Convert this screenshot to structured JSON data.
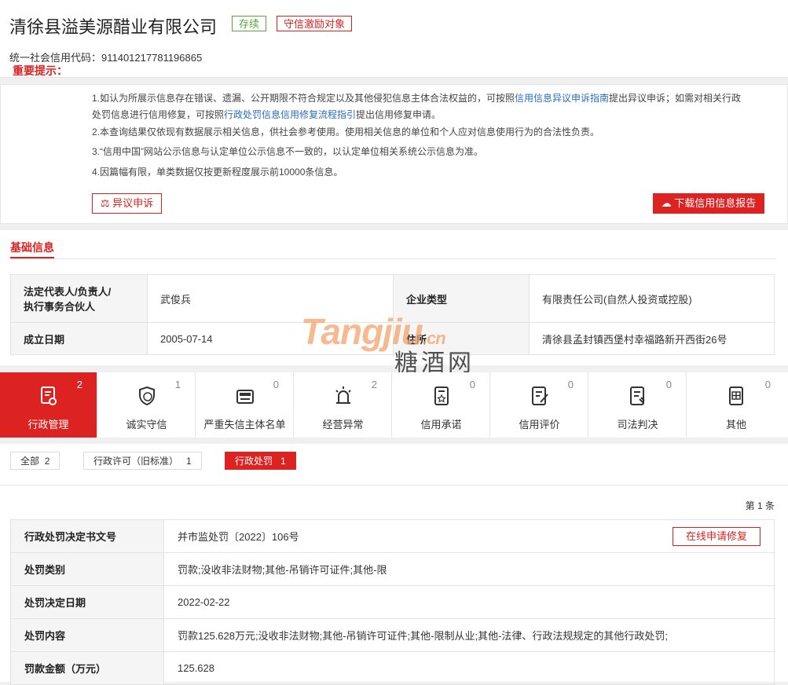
{
  "header": {
    "company_name": "清徐县溢美源醋业有限公司",
    "status_badge": "存续",
    "honor_badge": "守信激励对象",
    "credit_code": "统一社会信用代码：911401217781196865"
  },
  "notice": {
    "label": "重要提示：",
    "line1_a": "1.如认为所展示信息存在错误、遗漏、公开期限不符合规定以及其他侵犯信息主体合法权益的，可按照",
    "line1_link": "信用信息异议申诉指南",
    "line1_b": "提出异议申诉；如需对相关行政",
    "line1c_a": "处罚信息进行信用修复，可按照",
    "line1c_link": "行政处罚信息信用修复流程指引",
    "line1c_b": "提出信用修复申请。",
    "line2": "2.本查询结果仅依现有数据展示相关信息，供社会参考使用。使用相关信息的单位和个人应对信息使用行为的合法性负责。",
    "line3": "3.“信用中国”网站公示信息与认定单位公示信息不一致的，以认定单位相关系统公示信息为准。",
    "line4": "4.因篇幅有限，单类数据仅按更新程度展示前10000条信息。",
    "dispute_button": "异议申诉",
    "download_button": "下载信用信息报告"
  },
  "basic": {
    "section_title": "基础信息",
    "legal_rep_key": "法定代表人/负责人/执行事务合伙人",
    "legal_rep_key_l1": "法定代表人/负责人/",
    "legal_rep_key_l2": "执行事务合伙人",
    "legal_rep_value": "武俊兵",
    "type_key": "企业类型",
    "type_value": "有限责任公司(自然人投资或控股)",
    "founded_key": "成立日期",
    "founded_value": "2005-07-14",
    "address_key": "住所",
    "address_value": "清徐县孟封镇西堡村幸福路新开西街26号",
    "watermark": "Tangjiu",
    "watermark_domain": ".cn",
    "watermark_cn": "糖酒网"
  },
  "tabs": [
    {
      "label": "行政管理",
      "count": "2",
      "icon": "document-stamp-icon",
      "active": true
    },
    {
      "label": "诚实守信",
      "count": "1",
      "icon": "shield-honor-icon"
    },
    {
      "label": "严重失信主体名单",
      "count": "0",
      "icon": "blacklist-card-icon"
    },
    {
      "label": "经营异常",
      "count": "2",
      "icon": "alarm-light-icon"
    },
    {
      "label": "信用承诺",
      "count": "0",
      "icon": "promise-document-icon"
    },
    {
      "label": "信用评价",
      "count": "0",
      "icon": "evaluation-form-icon"
    },
    {
      "label": "司法判决",
      "count": "0",
      "icon": "judgment-document-icon"
    },
    {
      "label": "其他",
      "count": "0",
      "icon": "other-document-icon"
    }
  ],
  "filters": [
    {
      "label": "全部",
      "count": "2"
    },
    {
      "label": "行政许可（旧标准）",
      "count": "1"
    },
    {
      "label": "行政处罚",
      "count": "1",
      "active": true
    }
  ],
  "list": {
    "count_text": "第 1 条",
    "repair_button": "在线申请修复",
    "rows": [
      {
        "key": "行政处罚决定书文号",
        "value": "并市监处罚〔2022〕106号"
      },
      {
        "key": "处罚类别",
        "value": "罚款;没收非法财物;其他-吊销许可证件;其他-限"
      },
      {
        "key": "处罚决定日期",
        "value": "2022-02-22"
      },
      {
        "key": "处罚内容",
        "value": "罚款125.628万元;没收非法财物;其他-吊销许可证件;其他-限制从业;其他-法律、行政法规规定的其他行政处罚;"
      },
      {
        "key": "罚款金额（万元）",
        "value": "125.628"
      }
    ]
  }
}
